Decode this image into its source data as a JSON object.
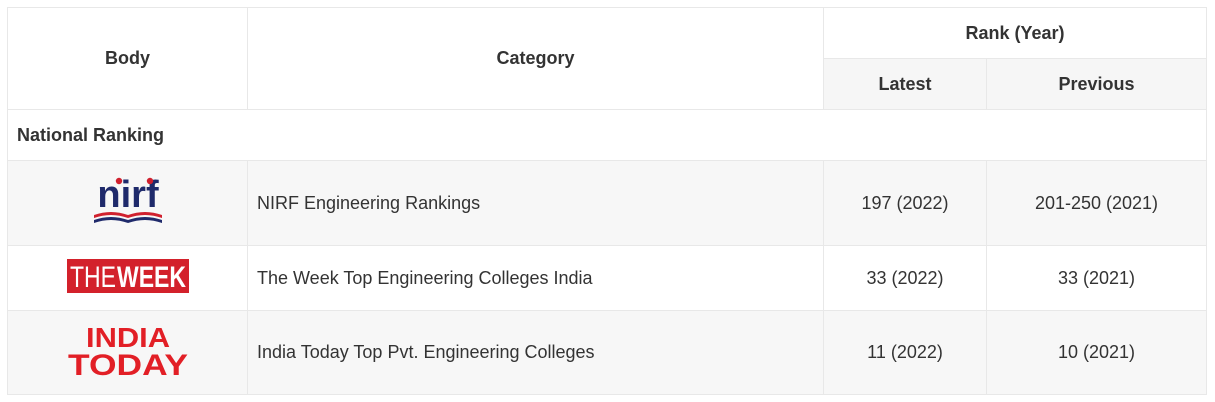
{
  "header": {
    "body": "Body",
    "category": "Category",
    "rank_year": "Rank (Year)",
    "latest": "Latest",
    "previous": "Previous"
  },
  "section": {
    "title": "National Ranking"
  },
  "rows": [
    {
      "logo_text": "nirf",
      "category": "NIRF Engineering Rankings",
      "latest": "197 (2022)",
      "previous": "201-250 (2021)",
      "logo_icon": "nirf-logo"
    },
    {
      "logo_text": "THEWEEK",
      "logo_text_a": "THE",
      "logo_text_b": "WEEK",
      "category": "The Week Top Engineering Colleges India",
      "latest": "33 (2022)",
      "previous": "33 (2021)",
      "logo_icon": "the-week-logo"
    },
    {
      "logo_text_a": "INDIA",
      "logo_text_b": "TODAY",
      "category": "India Today Top Pvt. Engineering Colleges",
      "latest": "11 (2022)",
      "previous": "10 (2021)",
      "logo_icon": "india-today-logo"
    }
  ],
  "colors": {
    "nirf_blue": "#1f2a6b",
    "nirf_red": "#d0202e",
    "week_red": "#d3212b",
    "today_red": "#e21f26"
  }
}
